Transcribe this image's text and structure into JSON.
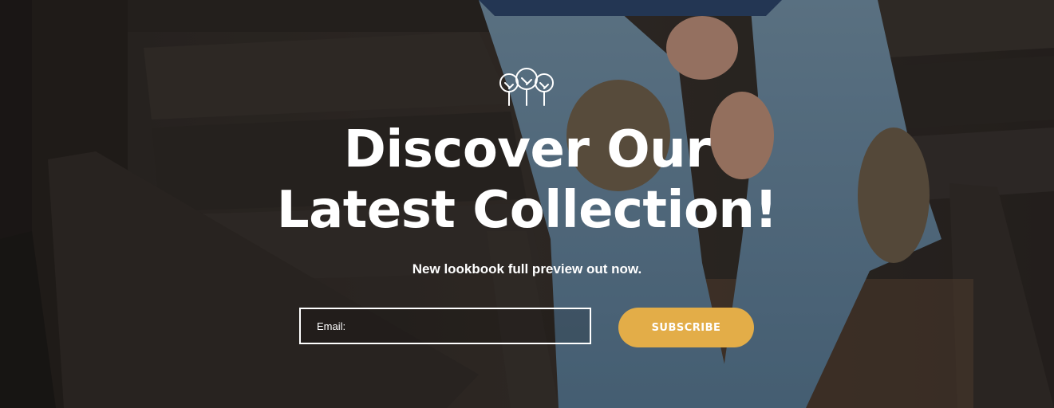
{
  "hero": {
    "logo_icon": "trees-icon",
    "headline_line1": "Discover Our",
    "headline_line2": "Latest Collection!",
    "subtitle": "New lookbook full preview out now.",
    "email_label": "Email:",
    "subscribe_label": "SUBSCRIBE"
  },
  "colors": {
    "accent": "#e3ad48",
    "text": "#ffffff",
    "background": "#2a2420"
  }
}
